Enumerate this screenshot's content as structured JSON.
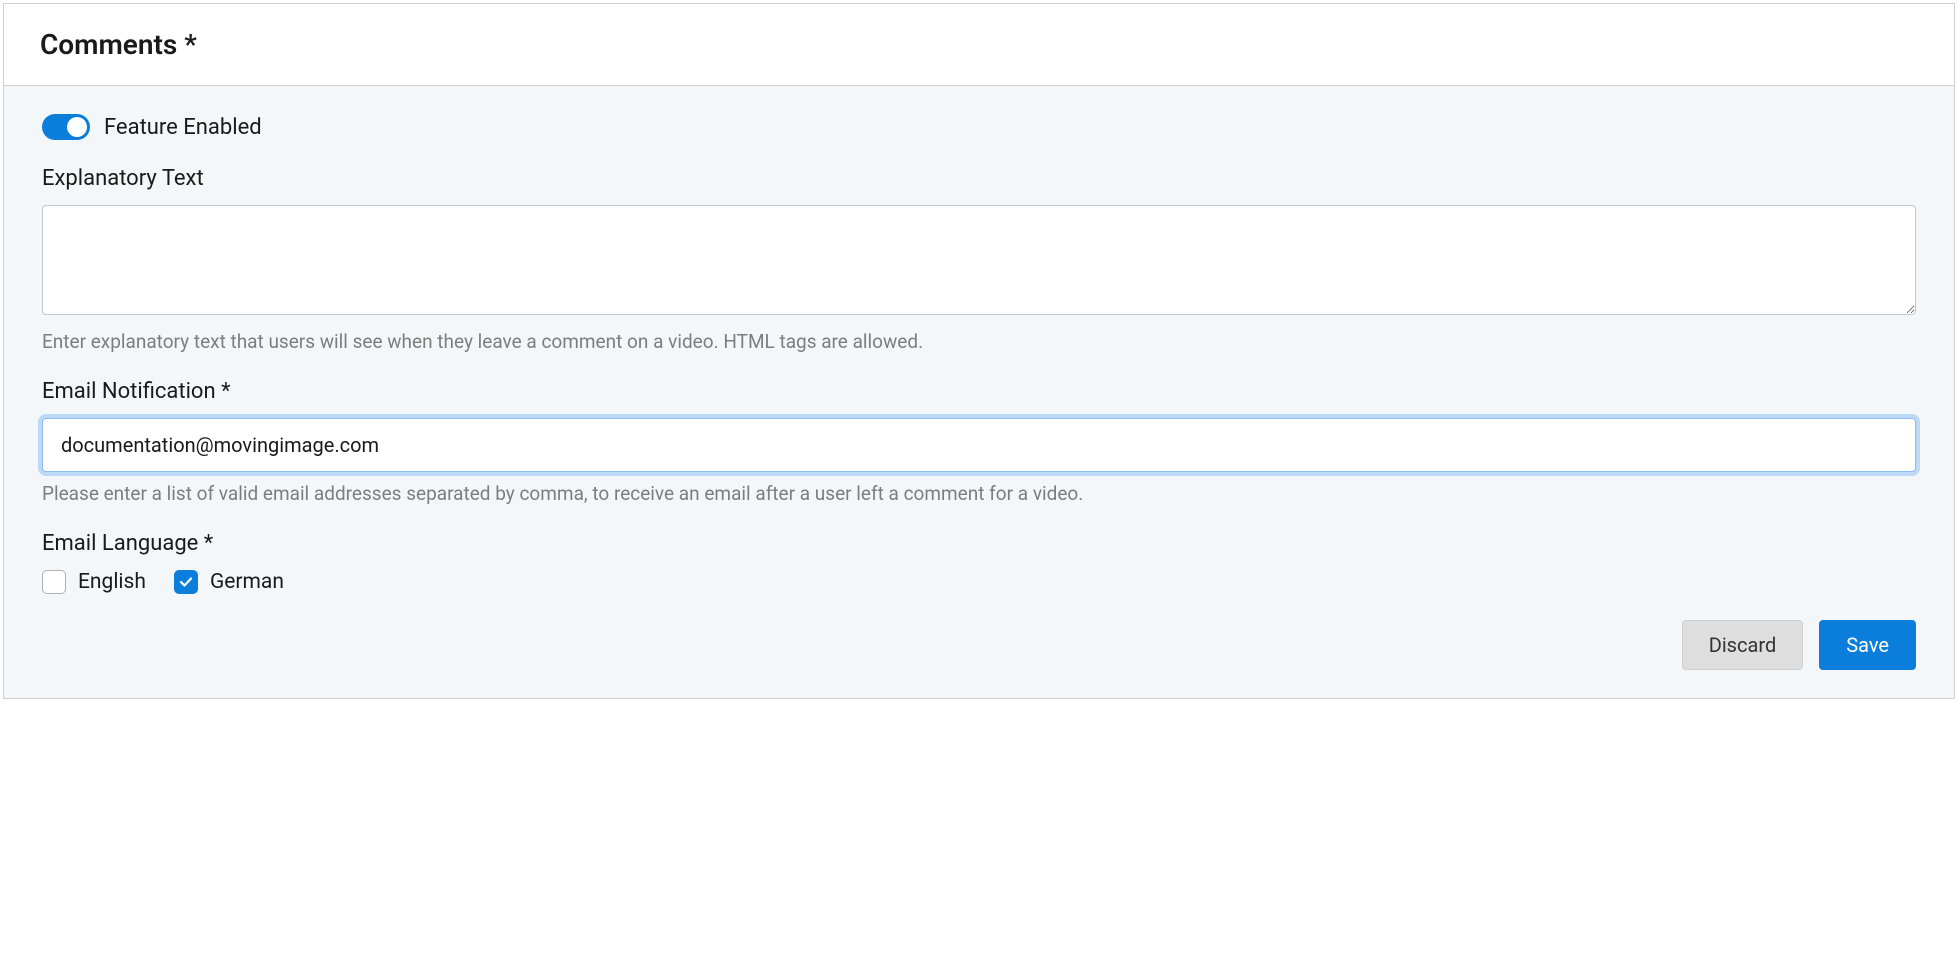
{
  "header": {
    "title": "Comments *"
  },
  "feature": {
    "enabled_label": "Feature Enabled"
  },
  "explanatory": {
    "label": "Explanatory Text",
    "value": "",
    "hint": "Enter explanatory text that users will see when they leave a comment on a video. HTML tags are allowed."
  },
  "email_notification": {
    "label": "Email Notification *",
    "value": "documentation@movingimage.com",
    "hint": "Please enter a list of valid email addresses separated by comma, to receive an email after a user left a comment for a video."
  },
  "email_language": {
    "label": "Email Language *",
    "options": {
      "english": "English",
      "german": "German"
    }
  },
  "buttons": {
    "discard": "Discard",
    "save": "Save"
  }
}
